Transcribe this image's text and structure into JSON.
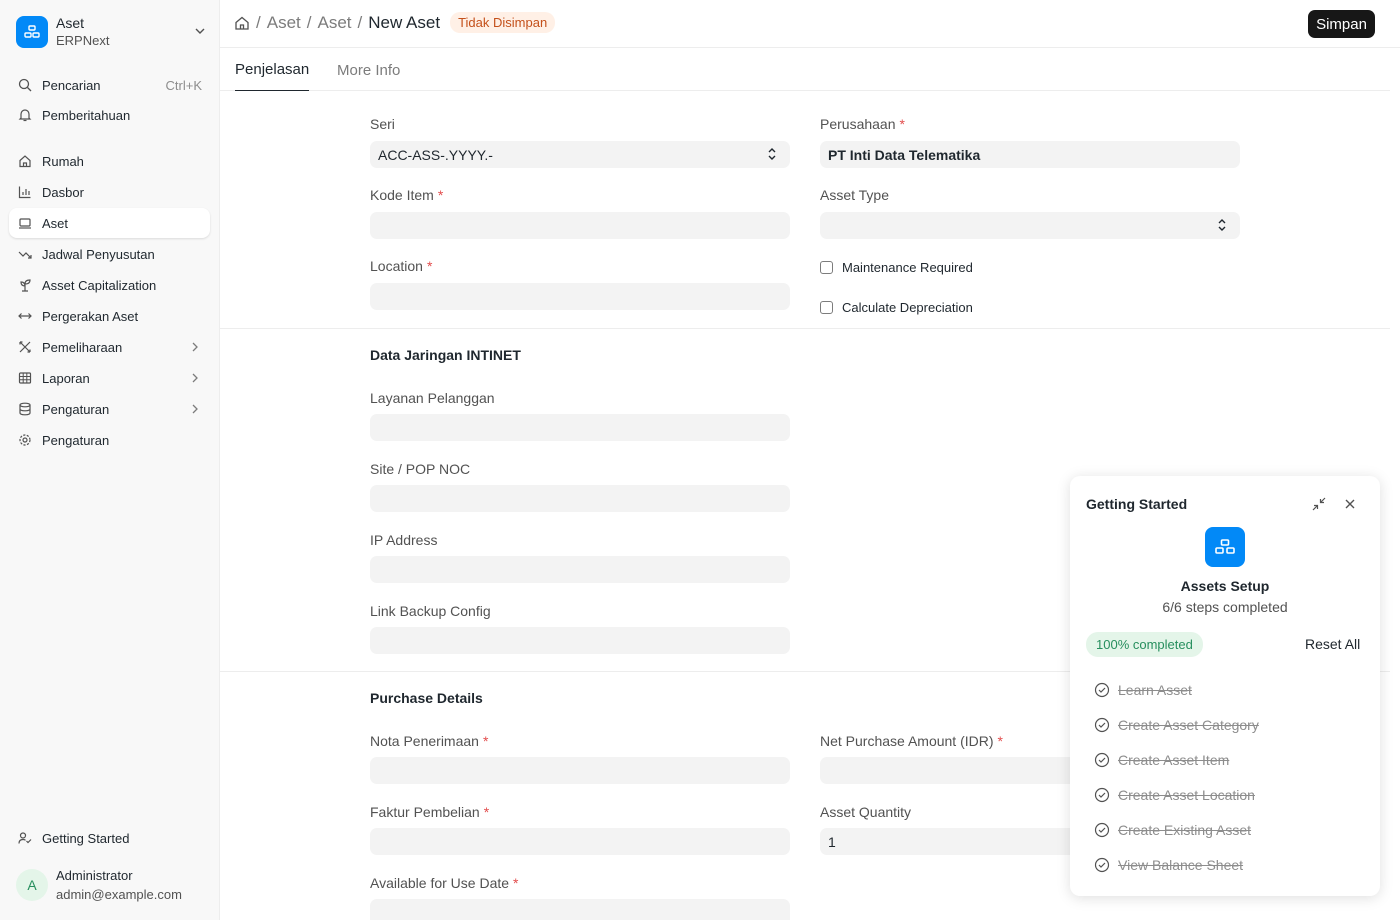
{
  "app": {
    "title": "Aset",
    "subtitle": "ERPNext"
  },
  "sidebar": {
    "search_label": "Pencarian",
    "search_shortcut": "Ctrl+K",
    "notifications_label": "Pemberitahuan",
    "items": [
      {
        "label": "Rumah",
        "icon": "home-icon"
      },
      {
        "label": "Dasbor",
        "icon": "bar-chart-icon"
      },
      {
        "label": "Aset",
        "icon": "laptop-icon",
        "active": true
      },
      {
        "label": "Jadwal Penyusutan",
        "icon": "trending-down-icon"
      },
      {
        "label": "Asset Capitalization",
        "icon": "sprout-icon"
      },
      {
        "label": "Pergerakan Aset",
        "icon": "arrows-horizontal-icon"
      },
      {
        "label": "Pemeliharaan",
        "icon": "tools-icon",
        "expandable": true
      },
      {
        "label": "Laporan",
        "icon": "table-icon",
        "expandable": true
      },
      {
        "label": "Pengaturan",
        "icon": "database-icon",
        "expandable": true
      },
      {
        "label": "Pengaturan",
        "icon": "gear-icon"
      }
    ],
    "getting_started_label": "Getting Started",
    "user": {
      "initial": "A",
      "name": "Administrator",
      "email": "admin@example.com"
    }
  },
  "header": {
    "breadcrumbs": [
      "Aset",
      "Aset",
      "New Aset"
    ],
    "status_badge": "Tidak Disimpan",
    "save_label": "Simpan"
  },
  "tabs": [
    "Penjelasan",
    "More Info"
  ],
  "form": {
    "seri_label": "Seri",
    "seri_value": "ACC-ASS-.YYYY.-",
    "perusahaan_label": "Perusahaan",
    "perusahaan_value": "PT Inti Data Telematika",
    "kode_item_label": "Kode Item",
    "asset_type_label": "Asset Type",
    "location_label": "Location",
    "maintenance_label": "Maintenance Required",
    "depreciation_label": "Calculate Depreciation",
    "section_jaringan": "Data Jaringan INTINET",
    "layanan_label": "Layanan Pelanggan",
    "site_label": "Site / POP NOC",
    "ip_label": "IP Address",
    "backup_label": "Link Backup Config",
    "section_purchase": "Purchase Details",
    "nota_label": "Nota Penerimaan",
    "net_purchase_label": "Net Purchase Amount (IDR)",
    "faktur_label": "Faktur Pembelian",
    "qty_label": "Asset Quantity",
    "qty_value": "1",
    "available_label": "Available for Use Date"
  },
  "getting_started": {
    "title": "Getting Started",
    "module": "Assets Setup",
    "steps_text": "6/6 steps completed",
    "progress_text": "100% completed",
    "progress": 1.0,
    "reset_label": "Reset All",
    "steps": [
      "Learn Asset",
      "Create Asset Category",
      "Create Asset Item",
      "Create Asset Location",
      "Create Existing Asset",
      "View Balance Sheet"
    ]
  },
  "colors": {
    "brand": "#0289f7",
    "save_button": "#171717",
    "unsaved_badge_bg": "#fff0e6",
    "unsaved_badge_text": "#c4501a",
    "success_bg": "#e4f5e9",
    "success_text": "#278f5e",
    "required": "#e24c4c"
  }
}
